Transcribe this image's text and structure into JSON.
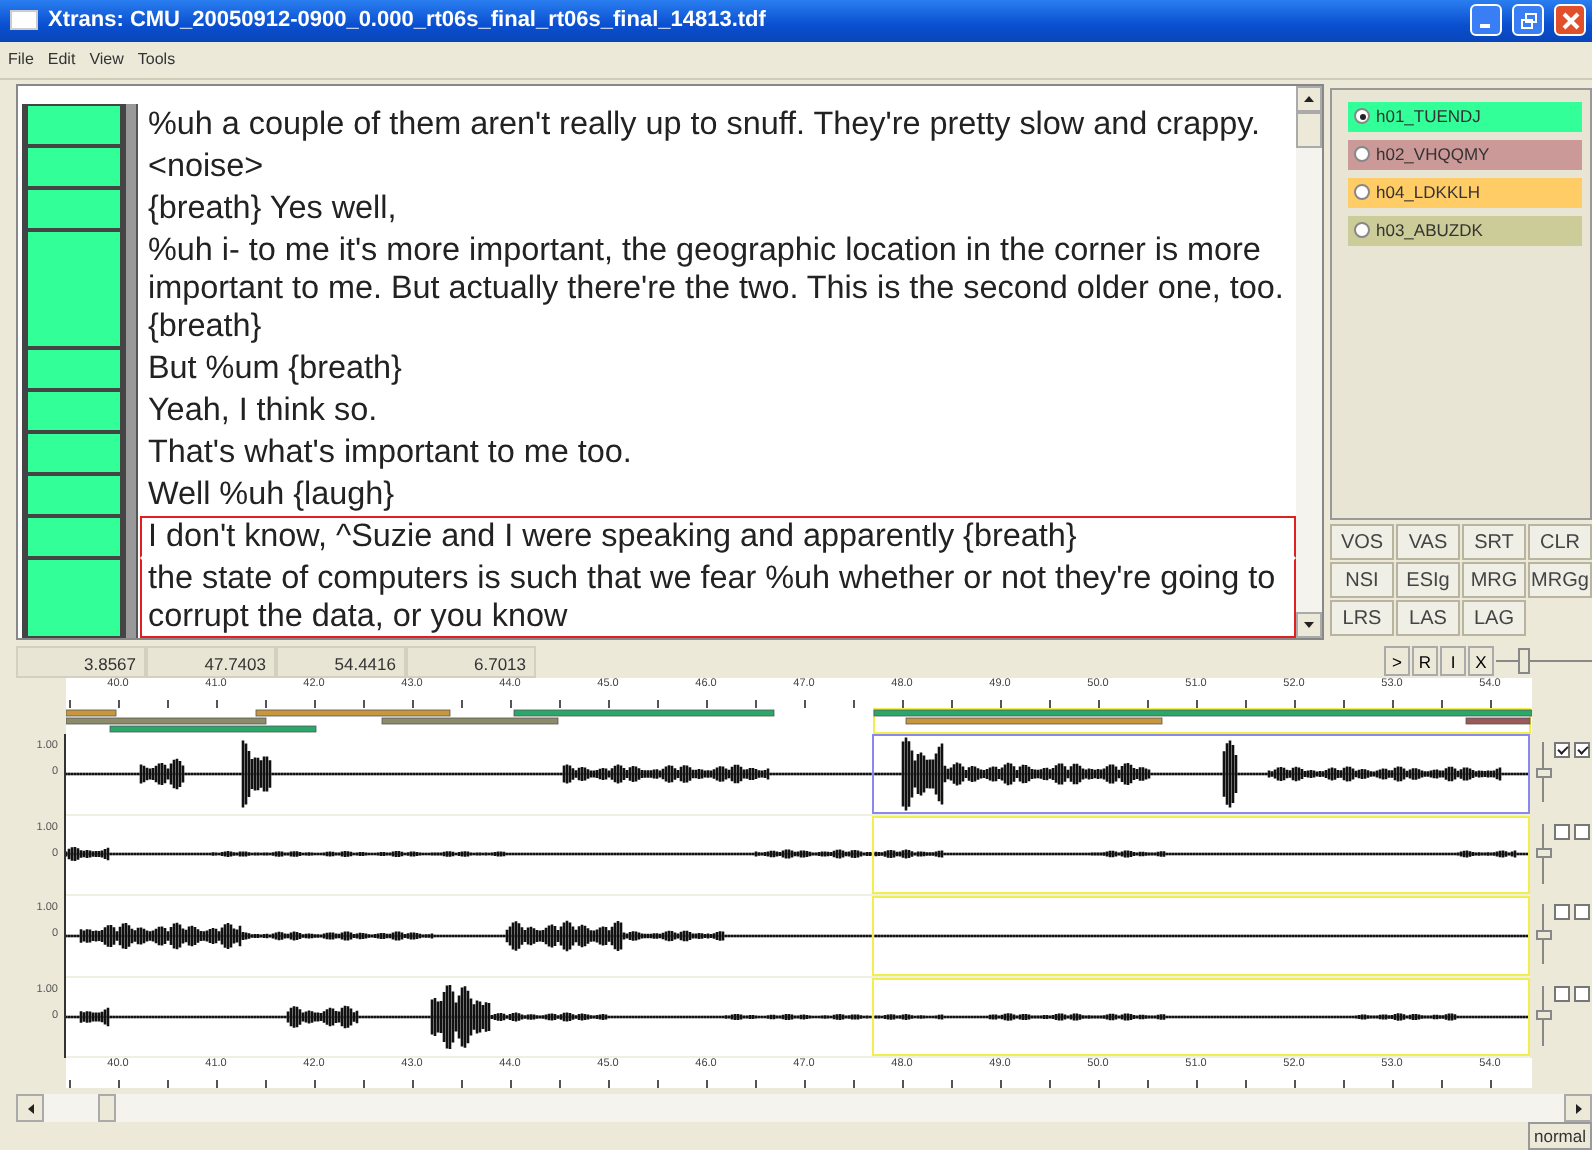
{
  "window": {
    "title": "Xtrans: CMU_20050912-0900_0.000_rt06s_final_rt06s_final_14813.tdf"
  },
  "menu": [
    "File",
    "Edit",
    "View",
    "Tools"
  ],
  "segments": [
    {
      "text": "%uh a couple of them aren't really up to snuff. They're pretty slow and crappy.",
      "selected": false
    },
    {
      "text": "<noise>",
      "selected": false
    },
    {
      "text": "{breath} Yes well,",
      "selected": false
    },
    {
      "text": "%uh i- to me it's more important, the geographic location in the corner is more important to me. But actually there're the two. This is the second older one, too. {breath}",
      "selected": false
    },
    {
      "text": "But %um {breath}",
      "selected": false
    },
    {
      "text": "Yeah, I think so.",
      "selected": false
    },
    {
      "text": "That's what's important to me too.",
      "selected": false
    },
    {
      "text": "Well %uh {laugh}",
      "selected": false
    },
    {
      "text": "I don't know, ^Suzie and I were speaking and apparently {breath}",
      "selected": true
    },
    {
      "text": "the state of computers is such that we fear %uh whether or not they're going to corrupt the data, or you know",
      "selected": true
    }
  ],
  "speakers": [
    {
      "name": "h01_TUENDJ",
      "color": "#33ff99",
      "selected": true
    },
    {
      "name": "h02_VHQQMY",
      "color": "#cc9999",
      "selected": false
    },
    {
      "name": "h04_LDKKLH",
      "color": "#ffcc66",
      "selected": false
    },
    {
      "name": "h03_ABUZDK",
      "color": "#cccc99",
      "selected": false
    }
  ],
  "command_buttons": [
    "VOS",
    "VAS",
    "SRT",
    "CLR",
    "NSI",
    "ESIg",
    "MRG",
    "MRGg",
    "LRS",
    "LAS",
    "LAG"
  ],
  "time_fields": [
    "3.8567",
    "47.7403",
    "54.4416",
    "6.7013"
  ],
  "zoom_buttons": [
    ">",
    "R",
    "I",
    "X"
  ],
  "zoom_slider": {
    "level": 0.25
  },
  "ruler_labels": [
    "40.0",
    "41.0",
    "42.0",
    "43.0",
    "44.0",
    "45.0",
    "46.0",
    "47.0",
    "48.0",
    "49.0",
    "50.0",
    "51.0",
    "52.0",
    "53.0",
    "54.0"
  ],
  "tracks": [
    {
      "y_max": "1.00",
      "y_zero": "0",
      "selected": true,
      "checks": [
        true,
        true
      ],
      "level": 0.5
    },
    {
      "y_max": "1.00",
      "y_zero": "0",
      "selected": false,
      "checks": [
        false,
        false
      ],
      "level": 0.5
    },
    {
      "y_max": "1.00",
      "y_zero": "0",
      "selected": false,
      "checks": [
        false,
        false
      ],
      "level": 0.5
    },
    {
      "y_max": "1.00",
      "y_zero": "0",
      "selected": false,
      "checks": [
        false,
        false
      ],
      "level": 0.5
    }
  ],
  "bottom_ruler_labels": [
    "40.0",
    "41.0",
    "42.0",
    "43.0",
    "44.0",
    "45.0",
    "46.0",
    "47.0",
    "48.0",
    "49.0",
    "50.0",
    "51.0",
    "52.0",
    "53.0",
    "54.0"
  ],
  "status": "normal"
}
